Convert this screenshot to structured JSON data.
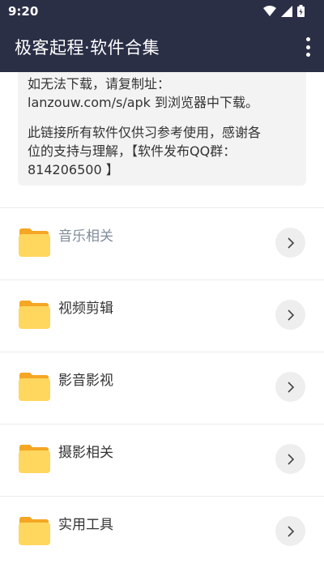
{
  "status_bar": {
    "time": "9:20",
    "icons": [
      "wifi-icon",
      "signal-icon",
      "battery-icon"
    ]
  },
  "app_bar": {
    "title": "极客起程·软件合集",
    "menu_icon": "more-vert-icon"
  },
  "notice": {
    "line1": "如无法下载，请复制址：",
    "line2": "lanzouw.com/s/apk 到浏览器中下载。",
    "line3": "此链接所有软件仅供习参考使用，感谢各",
    "line4": "位的支持与理解，【软件发布QQ群：",
    "line5": "814206500 】"
  },
  "categories": [
    {
      "label": "音乐相关",
      "icon": "folder-icon",
      "action_icon": "chevron-right-icon"
    },
    {
      "label": "视频剪辑",
      "icon": "folder-icon",
      "action_icon": "chevron-right-icon"
    },
    {
      "label": "影音影视",
      "icon": "folder-icon",
      "action_icon": "chevron-right-icon"
    },
    {
      "label": "摄影相关",
      "icon": "folder-icon",
      "action_icon": "chevron-right-icon"
    },
    {
      "label": "实用工具",
      "icon": "folder-icon",
      "action_icon": "chevron-right-icon"
    }
  ],
  "colors": {
    "app_bar": "#2b2f46",
    "folder_back": "#f5a623",
    "folder_front": "#ffd75e",
    "muted_label": "#7f8d9a"
  }
}
